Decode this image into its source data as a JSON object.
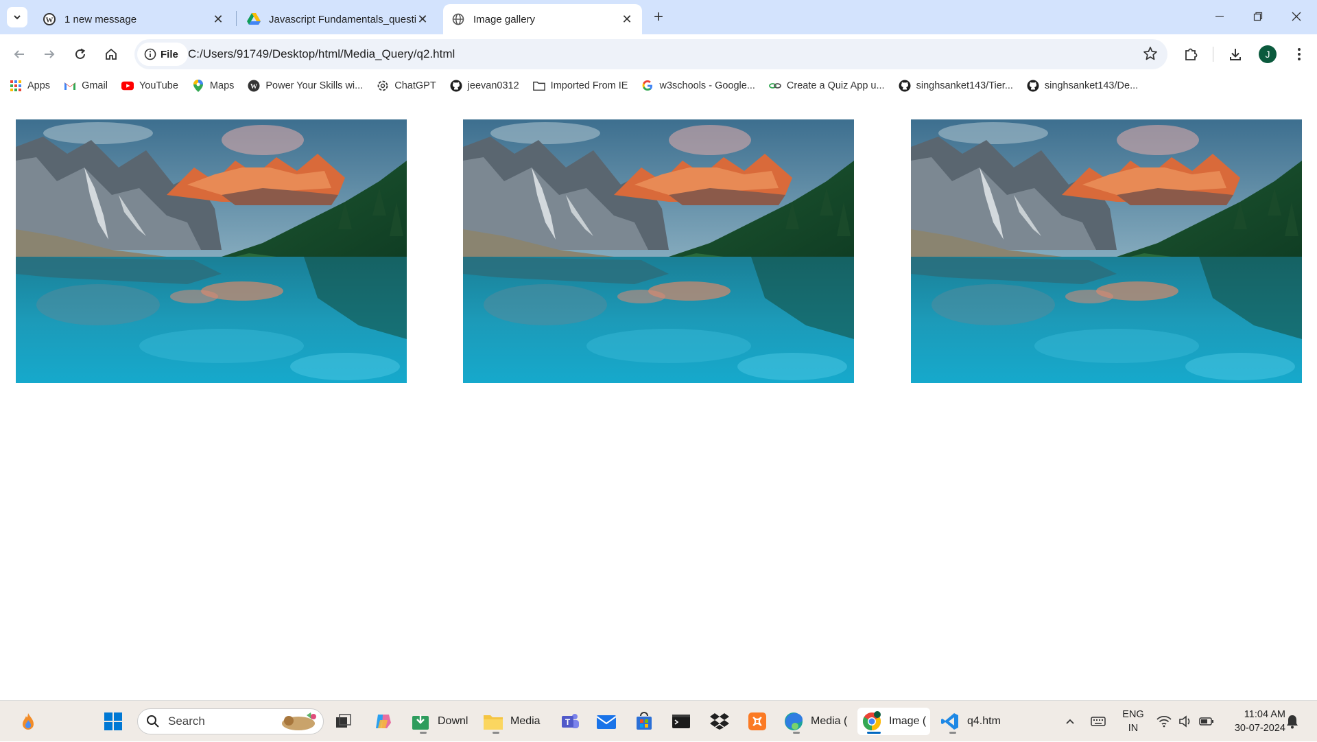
{
  "browser": {
    "tabs": [
      {
        "title": "1 new message",
        "icon": "wordpress-icon",
        "active": false
      },
      {
        "title": "Javascript Fundamentals_questi",
        "icon": "google-drive-icon",
        "active": false
      },
      {
        "title": "Image gallery",
        "icon": "globe-icon",
        "active": true
      }
    ],
    "address": {
      "chip_label": "File",
      "url": "C:/Users/91749/Desktop/html/Media_Query/q2.html"
    },
    "profile_initial": "J",
    "bookmarks": [
      {
        "label": "Apps",
        "icon": "apps-grid-icon"
      },
      {
        "label": "Gmail",
        "icon": "gmail-icon"
      },
      {
        "label": "YouTube",
        "icon": "youtube-icon"
      },
      {
        "label": "Maps",
        "icon": "maps-pin-icon"
      },
      {
        "label": "Power Your Skills wi...",
        "icon": "wordpress-icon"
      },
      {
        "label": "ChatGPT",
        "icon": "chatgpt-icon"
      },
      {
        "label": "jeevan0312",
        "icon": "github-icon"
      },
      {
        "label": "Imported From IE",
        "icon": "folder-icon"
      },
      {
        "label": "w3schools - Google...",
        "icon": "google-icon"
      },
      {
        "label": "Create a Quiz App u...",
        "icon": "link-icon"
      },
      {
        "label": "singhsanket143/Tier...",
        "icon": "github-icon"
      },
      {
        "label": "singhsanket143/De...",
        "icon": "github-icon"
      }
    ]
  },
  "gallery": {
    "images": [
      {
        "alt": "mountain-lake-landscape"
      },
      {
        "alt": "mountain-lake-landscape"
      },
      {
        "alt": "mountain-lake-landscape"
      }
    ]
  },
  "taskbar": {
    "search_placeholder": "Search",
    "apps": [
      {
        "label": "Downl",
        "icon": "downloads-icon"
      },
      {
        "label": "Media",
        "icon": "file-explorer-icon"
      },
      {
        "label": "Media (",
        "icon": "edge-icon"
      },
      {
        "label": "Image (",
        "icon": "chrome-icon"
      },
      {
        "label": "q4.htm",
        "icon": "vscode-icon"
      }
    ],
    "language": {
      "line1": "ENG",
      "line2": "IN"
    },
    "clock": {
      "time": "11:04 AM",
      "date": "30-07-2024"
    }
  },
  "colors": {
    "tabstrip_bg": "#d3e3fd",
    "omnibox_bg": "#eef2f9",
    "taskbar_bg": "#f0ebe6",
    "avatar_bg": "#0b5a3d"
  }
}
